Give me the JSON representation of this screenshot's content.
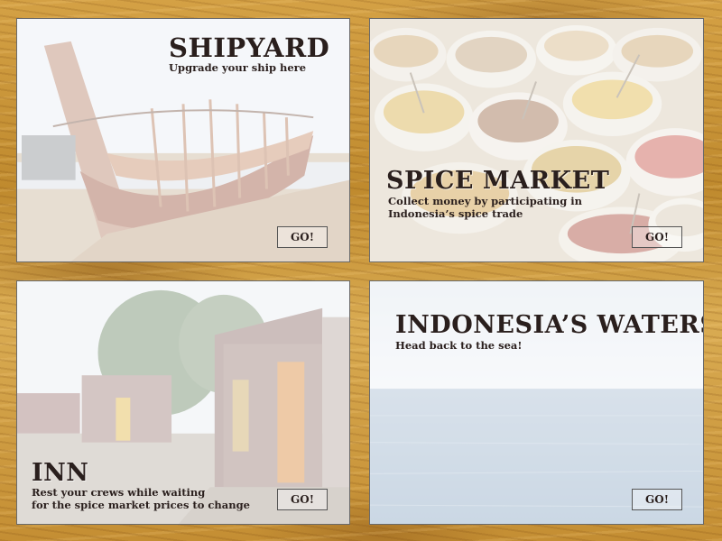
{
  "locations": [
    {
      "id": "shipyard",
      "title": "SHIPYARD",
      "description": "Upgrade your ship here",
      "button": "GO!",
      "image": "wooden-ship-under-construction"
    },
    {
      "id": "spice",
      "title": "SPICE MARKET",
      "description": "Collect money by participating in\nIndonesia’s spice trade",
      "button": "GO!",
      "image": "sacks-of-spices"
    },
    {
      "id": "inn",
      "title": "INN",
      "description": "Rest your crews while waiting\nfor the spice market prices to change",
      "button": "GO!",
      "image": "corrugated-metal-shacks"
    },
    {
      "id": "waters",
      "title": "INDONESIA’S WATERS",
      "description": "Head back to the sea!",
      "button": "GO!",
      "image": "open-sea-horizon"
    }
  ]
}
